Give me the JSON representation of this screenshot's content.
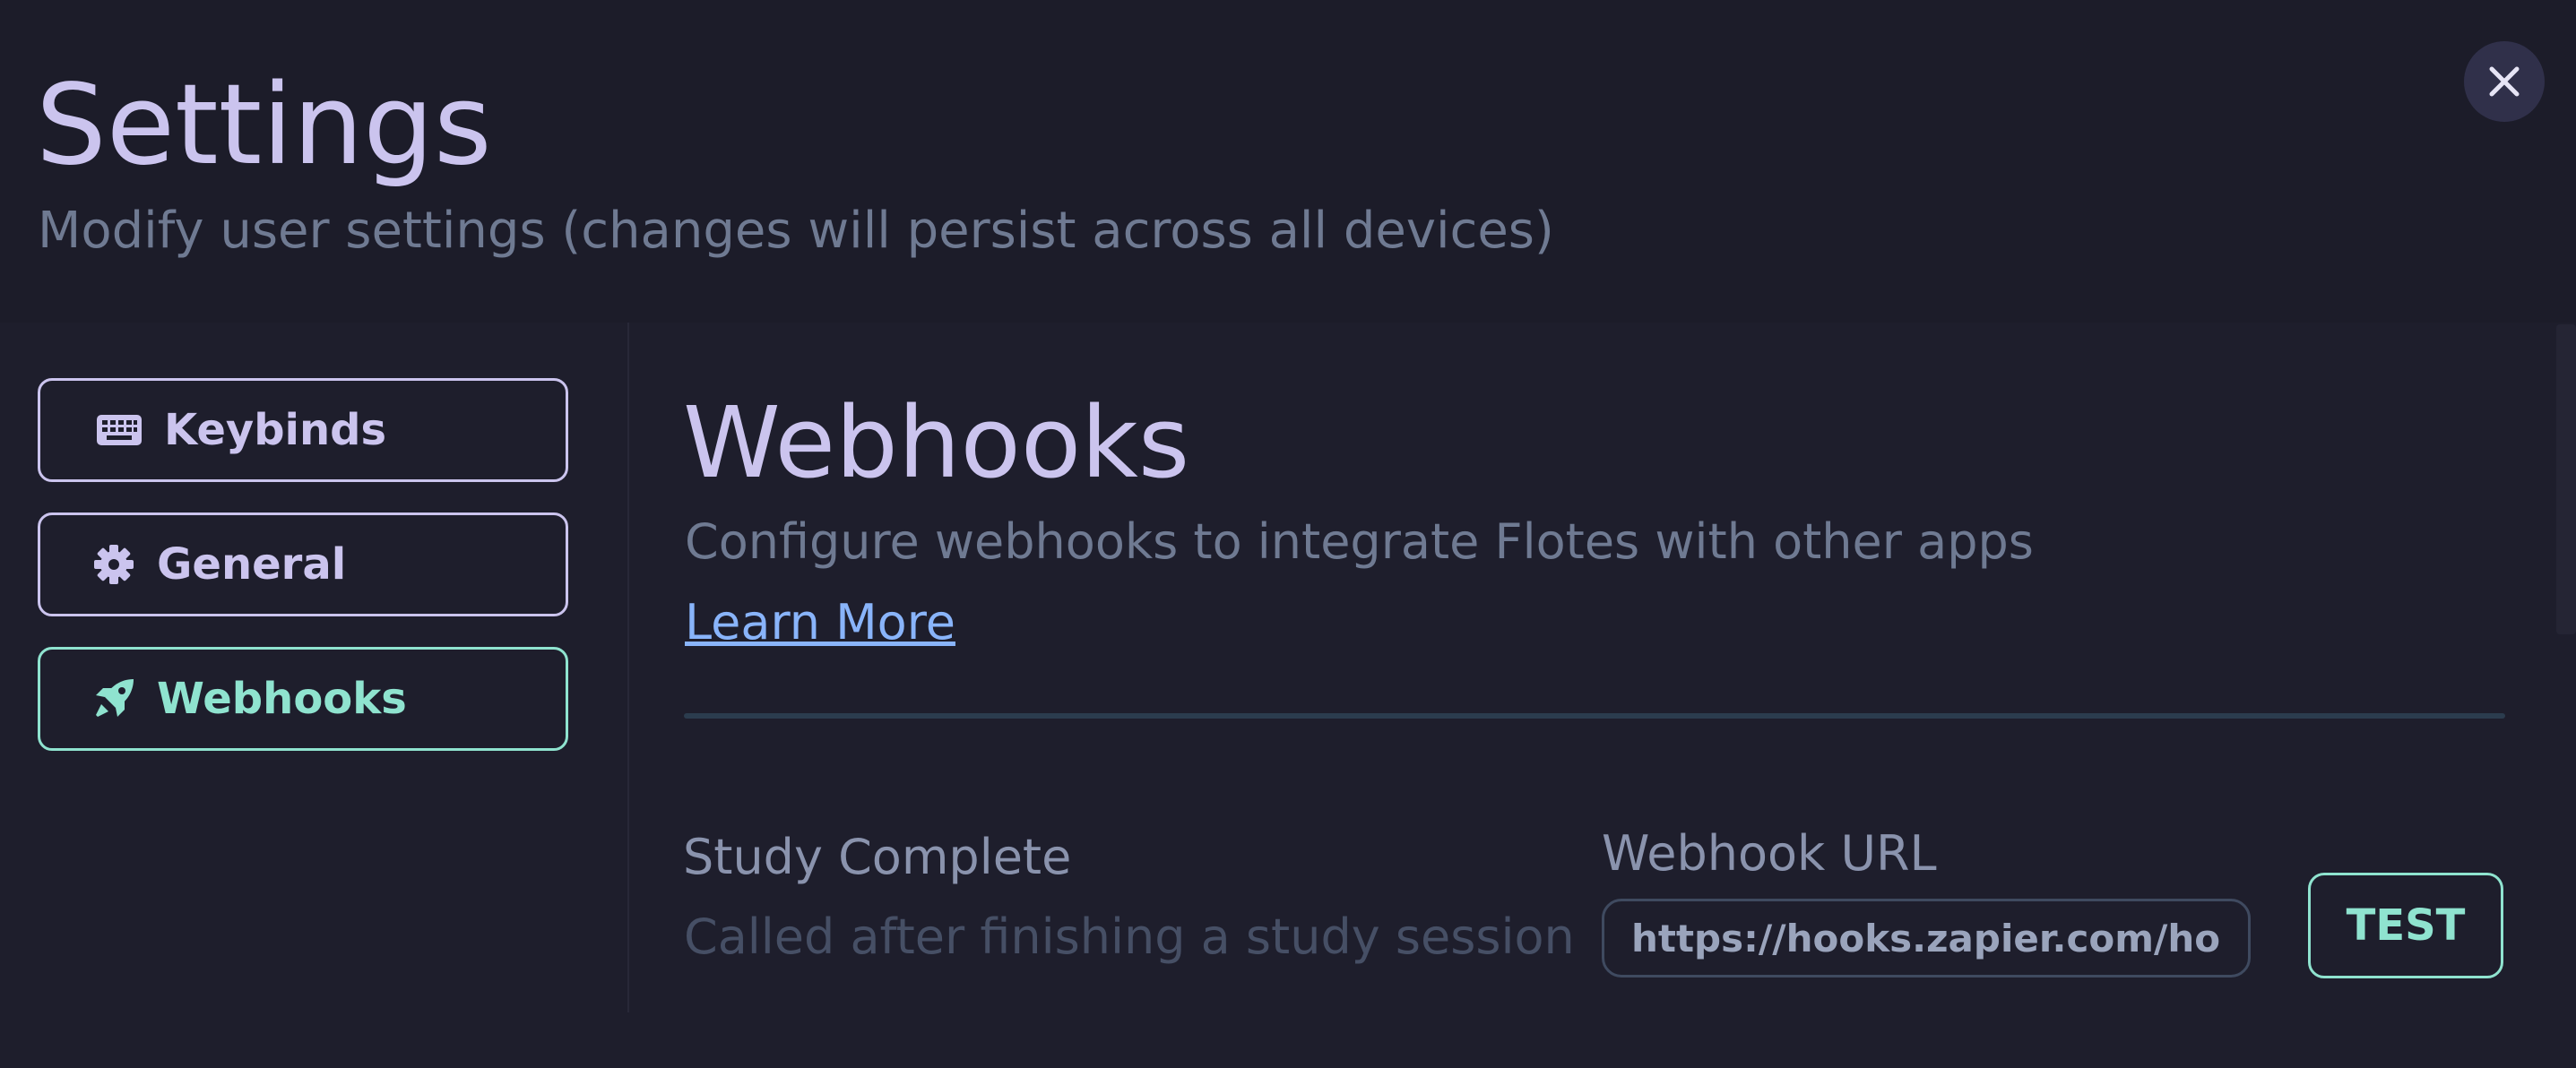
{
  "header": {
    "title": "Settings",
    "subtitle": "Modify user settings (changes will persist across all devices)",
    "close_icon": "close-icon"
  },
  "sidebar": {
    "items": [
      {
        "label": "Keybinds",
        "icon": "keyboard-icon",
        "active": false
      },
      {
        "label": "General",
        "icon": "gear-icon",
        "active": false
      },
      {
        "label": "Webhooks",
        "icon": "rocket-icon",
        "active": true
      }
    ]
  },
  "main": {
    "title": "Webhooks",
    "description": "Configure webhooks to integrate Flotes with other apps",
    "learn_more": "Learn More",
    "webhooks": [
      {
        "name": "Study Complete",
        "description": "Called after finishing a study session",
        "url_label": "Webhook URL",
        "url_value": "https://hooks.zapier.com/hooks/catch/",
        "test_label": "TEST"
      }
    ]
  },
  "colors": {
    "background": "#1e1e2c",
    "primary_text": "#cbc4ee",
    "accent": "#8fe3cf",
    "link": "#89b4fa",
    "muted": "#6f7a92"
  }
}
